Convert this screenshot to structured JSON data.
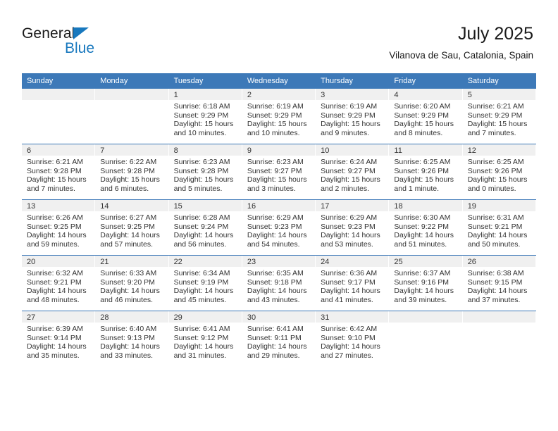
{
  "logo": {
    "primary_text": "General",
    "secondary_text": "Blue",
    "primary_color": "#1a1a1a",
    "accent_color": "#1878be"
  },
  "header": {
    "title": "July 2025",
    "subtitle": "Vilanova de Sau, Catalonia, Spain"
  },
  "theme": {
    "header_blue": "#3d79b8",
    "daynum_band": "#f0f0f0",
    "text": "#333333"
  },
  "calendar": {
    "weekday_headers": [
      "Sunday",
      "Monday",
      "Tuesday",
      "Wednesday",
      "Thursday",
      "Friday",
      "Saturday"
    ],
    "labels": {
      "sunrise": "Sunrise:",
      "sunset": "Sunset:",
      "daylight": "Daylight:"
    },
    "weeks": [
      [
        {
          "day": "",
          "empty": true
        },
        {
          "day": "",
          "empty": true
        },
        {
          "day": "1",
          "sunrise": "Sunrise: 6:18 AM",
          "sunset": "Sunset: 9:29 PM",
          "daylight": "Daylight: 15 hours and 10 minutes."
        },
        {
          "day": "2",
          "sunrise": "Sunrise: 6:19 AM",
          "sunset": "Sunset: 9:29 PM",
          "daylight": "Daylight: 15 hours and 10 minutes."
        },
        {
          "day": "3",
          "sunrise": "Sunrise: 6:19 AM",
          "sunset": "Sunset: 9:29 PM",
          "daylight": "Daylight: 15 hours and 9 minutes."
        },
        {
          "day": "4",
          "sunrise": "Sunrise: 6:20 AM",
          "sunset": "Sunset: 9:29 PM",
          "daylight": "Daylight: 15 hours and 8 minutes."
        },
        {
          "day": "5",
          "sunrise": "Sunrise: 6:21 AM",
          "sunset": "Sunset: 9:29 PM",
          "daylight": "Daylight: 15 hours and 7 minutes."
        }
      ],
      [
        {
          "day": "6",
          "sunrise": "Sunrise: 6:21 AM",
          "sunset": "Sunset: 9:28 PM",
          "daylight": "Daylight: 15 hours and 7 minutes."
        },
        {
          "day": "7",
          "sunrise": "Sunrise: 6:22 AM",
          "sunset": "Sunset: 9:28 PM",
          "daylight": "Daylight: 15 hours and 6 minutes."
        },
        {
          "day": "8",
          "sunrise": "Sunrise: 6:23 AM",
          "sunset": "Sunset: 9:28 PM",
          "daylight": "Daylight: 15 hours and 5 minutes."
        },
        {
          "day": "9",
          "sunrise": "Sunrise: 6:23 AM",
          "sunset": "Sunset: 9:27 PM",
          "daylight": "Daylight: 15 hours and 3 minutes."
        },
        {
          "day": "10",
          "sunrise": "Sunrise: 6:24 AM",
          "sunset": "Sunset: 9:27 PM",
          "daylight": "Daylight: 15 hours and 2 minutes."
        },
        {
          "day": "11",
          "sunrise": "Sunrise: 6:25 AM",
          "sunset": "Sunset: 9:26 PM",
          "daylight": "Daylight: 15 hours and 1 minute."
        },
        {
          "day": "12",
          "sunrise": "Sunrise: 6:25 AM",
          "sunset": "Sunset: 9:26 PM",
          "daylight": "Daylight: 15 hours and 0 minutes."
        }
      ],
      [
        {
          "day": "13",
          "sunrise": "Sunrise: 6:26 AM",
          "sunset": "Sunset: 9:25 PM",
          "daylight": "Daylight: 14 hours and 59 minutes."
        },
        {
          "day": "14",
          "sunrise": "Sunrise: 6:27 AM",
          "sunset": "Sunset: 9:25 PM",
          "daylight": "Daylight: 14 hours and 57 minutes."
        },
        {
          "day": "15",
          "sunrise": "Sunrise: 6:28 AM",
          "sunset": "Sunset: 9:24 PM",
          "daylight": "Daylight: 14 hours and 56 minutes."
        },
        {
          "day": "16",
          "sunrise": "Sunrise: 6:29 AM",
          "sunset": "Sunset: 9:23 PM",
          "daylight": "Daylight: 14 hours and 54 minutes."
        },
        {
          "day": "17",
          "sunrise": "Sunrise: 6:29 AM",
          "sunset": "Sunset: 9:23 PM",
          "daylight": "Daylight: 14 hours and 53 minutes."
        },
        {
          "day": "18",
          "sunrise": "Sunrise: 6:30 AM",
          "sunset": "Sunset: 9:22 PM",
          "daylight": "Daylight: 14 hours and 51 minutes."
        },
        {
          "day": "19",
          "sunrise": "Sunrise: 6:31 AM",
          "sunset": "Sunset: 9:21 PM",
          "daylight": "Daylight: 14 hours and 50 minutes."
        }
      ],
      [
        {
          "day": "20",
          "sunrise": "Sunrise: 6:32 AM",
          "sunset": "Sunset: 9:21 PM",
          "daylight": "Daylight: 14 hours and 48 minutes."
        },
        {
          "day": "21",
          "sunrise": "Sunrise: 6:33 AM",
          "sunset": "Sunset: 9:20 PM",
          "daylight": "Daylight: 14 hours and 46 minutes."
        },
        {
          "day": "22",
          "sunrise": "Sunrise: 6:34 AM",
          "sunset": "Sunset: 9:19 PM",
          "daylight": "Daylight: 14 hours and 45 minutes."
        },
        {
          "day": "23",
          "sunrise": "Sunrise: 6:35 AM",
          "sunset": "Sunset: 9:18 PM",
          "daylight": "Daylight: 14 hours and 43 minutes."
        },
        {
          "day": "24",
          "sunrise": "Sunrise: 6:36 AM",
          "sunset": "Sunset: 9:17 PM",
          "daylight": "Daylight: 14 hours and 41 minutes."
        },
        {
          "day": "25",
          "sunrise": "Sunrise: 6:37 AM",
          "sunset": "Sunset: 9:16 PM",
          "daylight": "Daylight: 14 hours and 39 minutes."
        },
        {
          "day": "26",
          "sunrise": "Sunrise: 6:38 AM",
          "sunset": "Sunset: 9:15 PM",
          "daylight": "Daylight: 14 hours and 37 minutes."
        }
      ],
      [
        {
          "day": "27",
          "sunrise": "Sunrise: 6:39 AM",
          "sunset": "Sunset: 9:14 PM",
          "daylight": "Daylight: 14 hours and 35 minutes."
        },
        {
          "day": "28",
          "sunrise": "Sunrise: 6:40 AM",
          "sunset": "Sunset: 9:13 PM",
          "daylight": "Daylight: 14 hours and 33 minutes."
        },
        {
          "day": "29",
          "sunrise": "Sunrise: 6:41 AM",
          "sunset": "Sunset: 9:12 PM",
          "daylight": "Daylight: 14 hours and 31 minutes."
        },
        {
          "day": "30",
          "sunrise": "Sunrise: 6:41 AM",
          "sunset": "Sunset: 9:11 PM",
          "daylight": "Daylight: 14 hours and 29 minutes."
        },
        {
          "day": "31",
          "sunrise": "Sunrise: 6:42 AM",
          "sunset": "Sunset: 9:10 PM",
          "daylight": "Daylight: 14 hours and 27 minutes."
        },
        {
          "day": "",
          "empty": true
        },
        {
          "day": "",
          "empty": true
        }
      ]
    ]
  }
}
